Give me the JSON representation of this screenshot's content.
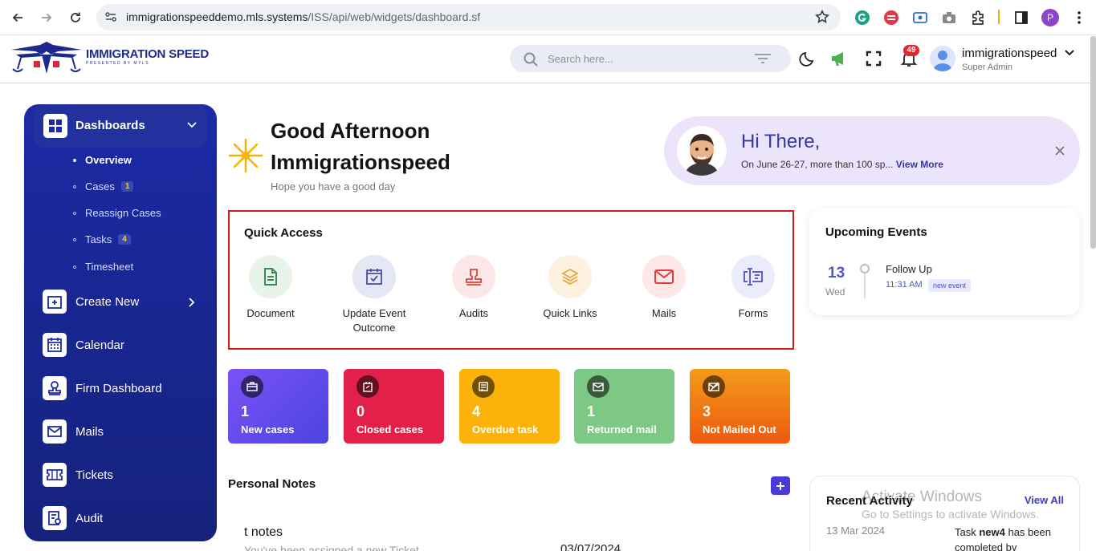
{
  "browser": {
    "url_host": "immigrationspeeddemo.mls.systems",
    "url_path": "/ISS/api/web/widgets/dashboard.sf",
    "profile_initial": "P"
  },
  "header": {
    "logo_title": "IMMIGRATION SPEED",
    "logo_subtitle": "PRESENTED BY MYLS",
    "search_placeholder": "Search here...",
    "notification_count": "49",
    "user_name": "immigrationspeed",
    "user_role": "Super Admin"
  },
  "sidebar": {
    "dashboards_label": "Dashboards",
    "sub_items": [
      {
        "label": "Overview",
        "count": ""
      },
      {
        "label": "Cases",
        "count": "1"
      },
      {
        "label": "Reassign Cases",
        "count": ""
      },
      {
        "label": "Tasks",
        "count": "4"
      },
      {
        "label": "Timesheet",
        "count": ""
      }
    ],
    "items": [
      {
        "label": "Create New",
        "icon": "add-box-icon"
      },
      {
        "label": "Calendar",
        "icon": "calendar-icon"
      },
      {
        "label": "Firm Dashboard",
        "icon": "stamp-icon"
      },
      {
        "label": "Mails",
        "icon": "mail-icon"
      },
      {
        "label": "Tickets",
        "icon": "ticket-icon"
      },
      {
        "label": "Audit",
        "icon": "audit-icon"
      }
    ]
  },
  "greeting": {
    "line1": "Good Afternoon",
    "line2": "Immigrationspeed",
    "subtitle": "Hope you have a good day"
  },
  "hi_card": {
    "title": "Hi There,",
    "text": "On June 26-27, more than 100 sp...",
    "link": "View More"
  },
  "quick_access": {
    "title": "Quick Access",
    "items": [
      {
        "label": "Document",
        "icon": "document-icon",
        "bg": "#e8f3ea",
        "fg": "#3c8a55"
      },
      {
        "label": "Update Event Outcome",
        "icon": "calendar-check-icon",
        "bg": "#e5e7f4",
        "fg": "#4a4fa0"
      },
      {
        "label": "Audits",
        "icon": "stamp-icon",
        "bg": "#fbe7e7",
        "fg": "#d9463d"
      },
      {
        "label": "Quick Links",
        "icon": "layers-icon",
        "bg": "#fdf1df",
        "fg": "#e5a53d"
      },
      {
        "label": "Mails",
        "icon": "mail-icon",
        "bg": "#fde7e7",
        "fg": "#e23c3c"
      },
      {
        "label": "Forms",
        "icon": "form-icon",
        "bg": "#ecebfb",
        "fg": "#4f4ec9"
      }
    ]
  },
  "events": {
    "title": "Upcoming Events",
    "day": "13",
    "weekday": "Wed",
    "name": "Follow Up",
    "time": "11:31 AM",
    "badge": "new event"
  },
  "stats": [
    {
      "value": "1",
      "label": "New cases",
      "color": "#5b4bf0"
    },
    {
      "value": "0",
      "label": "Closed cases",
      "color": "#e3204a"
    },
    {
      "value": "4",
      "label": "Overdue task",
      "color": "#fbb20a"
    },
    {
      "value": "1",
      "label": "Returned mail",
      "color": "#7cc884"
    },
    {
      "value": "3",
      "label": "Not Mailed Out",
      "color": "#f0781a"
    }
  ],
  "notes": {
    "title": "Personal Notes",
    "item_name": "t notes",
    "item_text": "You've been assigned a new Ticket",
    "item_date": "03/07/2024"
  },
  "recent": {
    "title": "Recent Activity",
    "view_all": "View All",
    "date": "13 Mar 2024",
    "text_pre": "Task ",
    "text_bold": "new4",
    "text_post": " has been completed by"
  },
  "watermark": {
    "line1": "Activate Windows",
    "line2": "Go to Settings to activate Windows."
  }
}
